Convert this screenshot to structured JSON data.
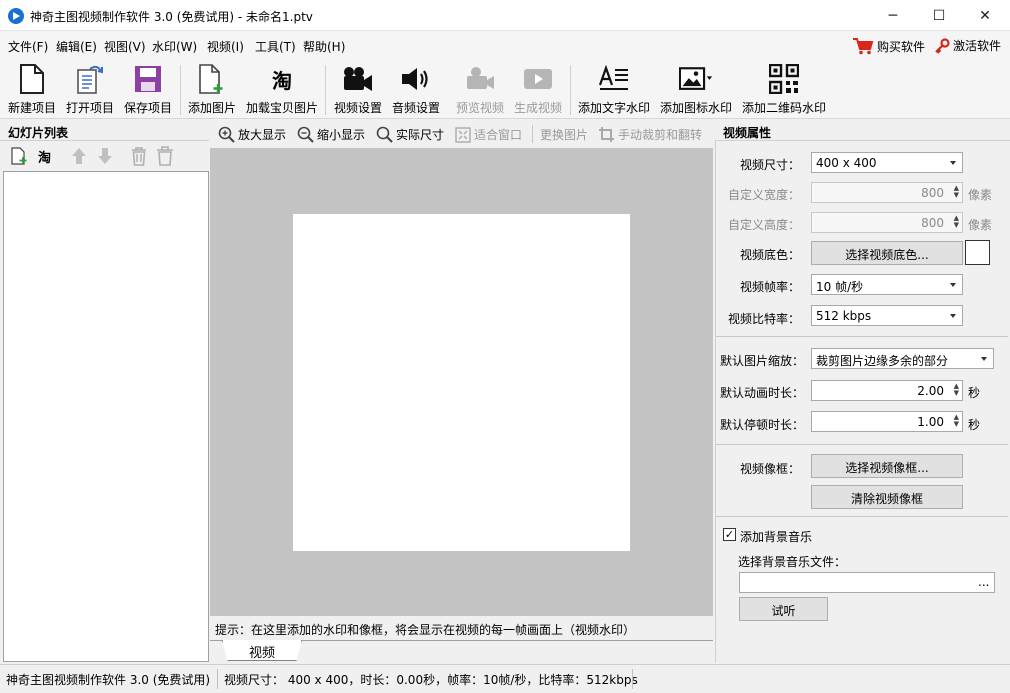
{
  "window": {
    "title": "神奇主图视频制作软件 3.0 (免费试用) - 未命名1.ptv",
    "controls": {
      "minimize": "─",
      "maximize": "☐",
      "close": "✕"
    }
  },
  "menu": {
    "items": [
      "文件(F)",
      "编辑(E)",
      "视图(V)",
      "水印(W)",
      "视频(I)",
      "工具(T)",
      "帮助(H)"
    ],
    "buy": "购买软件",
    "activate": "激活软件"
  },
  "toolbar": {
    "new_project": "新建项目",
    "open_project": "打开项目",
    "save_project": "保存项目",
    "add_image": "添加图片",
    "load_taobao": "加载宝贝图片",
    "video_settings": "视频设置",
    "audio_settings": "音频设置",
    "preview_video": "预览视频",
    "generate_video": "生成视频",
    "add_text_watermark": "添加文字水印",
    "add_icon_watermark": "添加图标水印",
    "add_qr_watermark": "添加二维码水印",
    "taobao_glyph": "淘"
  },
  "left_panel": {
    "title": "幻灯片列表",
    "taobao_glyph": "淘"
  },
  "canvas_toolbar": {
    "zoom_in": "放大显示",
    "zoom_out": "缩小显示",
    "actual_size": "实际尺寸",
    "fit_window": "适合窗口",
    "replace_image": "更换图片",
    "manual_crop": "手动裁剪和翻转"
  },
  "canvas": {
    "hint": "提示：在这里添加的水印和像框，将会显示在视频的每一帧画面上（视频水印）",
    "tab_label": "视频"
  },
  "properties": {
    "title": "视频属性",
    "video_size_label": "视频尺寸：",
    "video_size_value": "400 x 400",
    "custom_width_label": "自定义宽度：",
    "custom_width_value": "800",
    "custom_height_label": "自定义高度：",
    "custom_height_value": "800",
    "pixel_unit": "像素",
    "bg_color_label": "视频底色：",
    "bg_color_button": "选择视频底色...",
    "bg_color_swatch": "#ffffff",
    "fps_label": "视频帧率：",
    "fps_value": "10 帧/秒",
    "bitrate_label": "视频比特率：",
    "bitrate_value": "512 kbps",
    "scale_label": "默认图片缩放：",
    "scale_value": "裁剪图片边缘多余的部分",
    "anim_label": "默认动画时长：",
    "anim_value": "2.00",
    "pause_label": "默认停顿时长：",
    "pause_value": "1.00",
    "second_unit": "秒",
    "frame_label": "视频像框：",
    "frame_button": "选择视频像框...",
    "clear_frame_button": "清除视频像框",
    "bg_music_checkbox": "添加背景音乐",
    "bg_music_checked": true,
    "bg_music_file_label": "选择背景音乐文件：",
    "bg_music_file_value": "",
    "browse_button": "...",
    "listen_button": "试听"
  },
  "status": {
    "app": "神奇主图视频制作软件 3.0 (免费试用)",
    "info": "视频尺寸：  400 x 400，时长：0.00秒，帧率：10帧/秒，比特率：512kbps"
  },
  "colors": {
    "accent": "#1b6fd1",
    "canvas_bg": "#c4c4c4",
    "cart_red": "#d9251c"
  }
}
